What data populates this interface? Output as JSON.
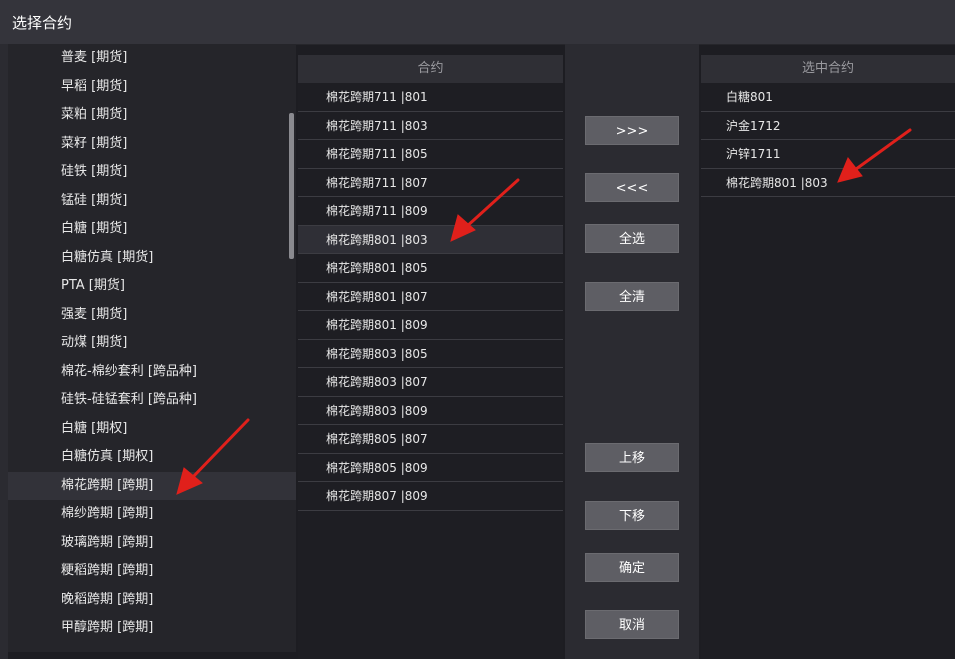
{
  "window": {
    "title": "选择合约"
  },
  "left_list": {
    "items": [
      "普麦 [期货]",
      "早稻 [期货]",
      "菜粕 [期货]",
      "菜籽 [期货]",
      "硅铁 [期货]",
      "锰硅 [期货]",
      "白糖 [期货]",
      "白糖仿真 [期货]",
      "PTA [期货]",
      "强麦 [期货]",
      "动煤 [期货]",
      "棉花-棉纱套利 [跨品种]",
      "硅铁-硅锰套利 [跨品种]",
      "白糖 [期权]",
      "白糖仿真 [期权]",
      "棉花跨期 [跨期]",
      "棉纱跨期 [跨期]",
      "玻璃跨期 [跨期]",
      "粳稻跨期 [跨期]",
      "晚稻跨期 [跨期]",
      "甲醇跨期 [跨期]"
    ],
    "selected_index": 15
  },
  "contracts": {
    "header": "合约",
    "rows": [
      "棉花跨期711 |801",
      "棉花跨期711 |803",
      "棉花跨期711 |805",
      "棉花跨期711 |807",
      "棉花跨期711 |809",
      "棉花跨期801 |803",
      "棉花跨期801 |805",
      "棉花跨期801 |807",
      "棉花跨期801 |809",
      "棉花跨期803 |805",
      "棉花跨期803 |807",
      "棉花跨期803 |809",
      "棉花跨期805 |807",
      "棉花跨期805 |809",
      "棉花跨期807 |809"
    ],
    "selected_index": 5
  },
  "buttons": {
    "add": ">>>",
    "remove": "<<<",
    "select_all": "全选",
    "clear_all": "全清",
    "move_up": "上移",
    "move_down": "下移",
    "ok": "确定",
    "cancel": "取消"
  },
  "selected_contracts": {
    "header": "选中合约",
    "rows": [
      "白糖801",
      "沪金1712",
      "沪锌1711",
      "棉花跨期801 |803"
    ]
  },
  "colors": {
    "annotation_arrow": "#e0201b"
  }
}
